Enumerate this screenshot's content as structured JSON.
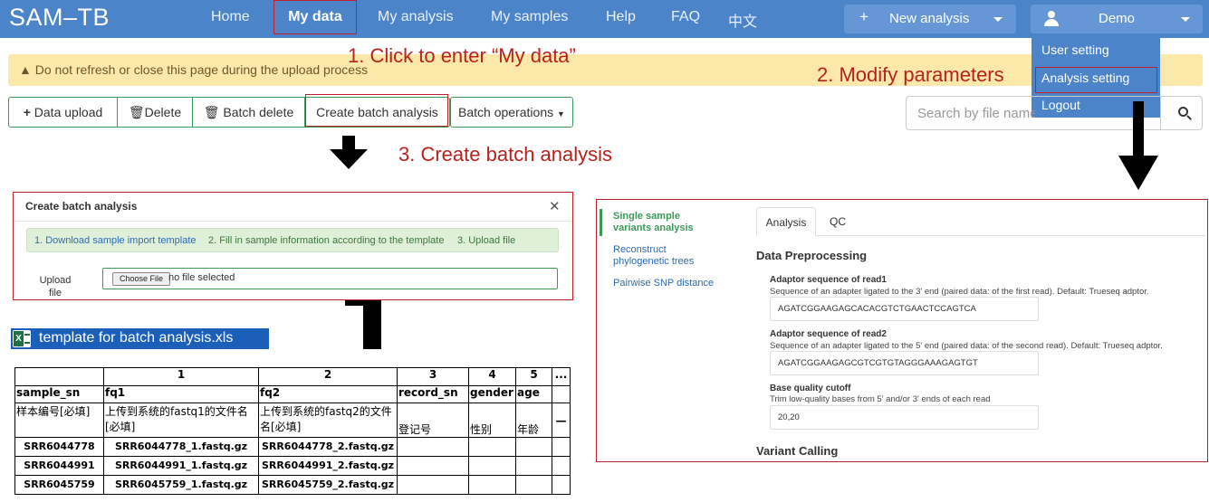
{
  "navbar": {
    "brand": "SAM–TB",
    "items": [
      "Home",
      "My data",
      "My analysis",
      "My samples",
      "Help",
      "FAQ",
      "中文"
    ],
    "new_analysis": "New analysis",
    "user": "Demo"
  },
  "user_menu": [
    "User setting",
    "Analysis setting",
    "Logout"
  ],
  "alert": "Do not refresh or close this page during the upload process",
  "toolbar": {
    "buttons": [
      "Data upload",
      "Delete",
      "Batch delete",
      "Create batch analysis",
      "Batch operations"
    ],
    "search_placeholder": "Search by file name"
  },
  "annotations": {
    "step1": "1. Click to enter “My data”",
    "step2": "2. Modify parameters",
    "step3": "3. Create batch analysis"
  },
  "batch_dialog": {
    "title": "Create batch analysis",
    "steps": [
      "1. Download sample import template",
      "2. Fill in sample information according to the template",
      "3. Upload file"
    ],
    "upload_label": "Upload file",
    "choose_file": "Choose File",
    "no_file": "no file selected"
  },
  "spreadsheet": {
    "filename": "template for batch analysis.xls",
    "col_numbers": [
      "",
      "1",
      "2",
      "3",
      "4",
      "5",
      "..."
    ],
    "headers": [
      "sample_sn",
      "fq1",
      "fq2",
      "record_sn",
      "gender",
      "age",
      ""
    ],
    "descriptions": [
      "样本编号[必填]",
      "上传到系统的fastq1的文件名[必填]",
      "上传到系统的fastq2的文件名[必填]",
      "登记号",
      "性别",
      "年龄",
      "—"
    ],
    "rows": [
      [
        "SRR6044778",
        "SRR6044778_1.fastq.gz",
        "SRR6044778_2.fastq.gz",
        "",
        "",
        "",
        ""
      ],
      [
        "SRR6044991",
        "SRR6044991_1.fastq.gz",
        "SRR6044991_2.fastq.gz",
        "",
        "",
        "",
        ""
      ],
      [
        "SRR6045759",
        "SRR6045759_1.fastq.gz",
        "SRR6045759_2.fastq.gz",
        "",
        "",
        "",
        ""
      ]
    ]
  },
  "settings": {
    "sidebar": [
      "Single sample variants analysis",
      "Reconstruct phylogenetic trees",
      "Pairwise SNP distance"
    ],
    "tabs": [
      "Analysis",
      "QC"
    ],
    "section1": "Data Preprocessing",
    "fields": [
      {
        "label": "Adaptor sequence of read1",
        "help": "Sequence of an adapter ligated to the 3' end (paired data: of the first read). Default: Trueseq adptor.",
        "value": "AGATCGGAAGAGCACACGTCTGAACTCCAGTCA"
      },
      {
        "label": "Adaptor sequence of read2",
        "help": "Sequence of an adapter ligated to the 5' end (paired data: of the second read). Default: Trueseq adptor.",
        "value": "AGATCGGAAGAGCGTCGTGTAGGGAAAGAGTGT"
      },
      {
        "label": "Base quality cutoff",
        "help": "Trim low-quality bases from 5' and/or 3' ends of each read",
        "value": "20,20"
      }
    ],
    "section2": "Variant Calling"
  },
  "colors": {
    "navbar": "#4c84c9",
    "annotation": "#b8211d",
    "accent_green": "#3b9a5a",
    "alert": "#fce9a9"
  }
}
